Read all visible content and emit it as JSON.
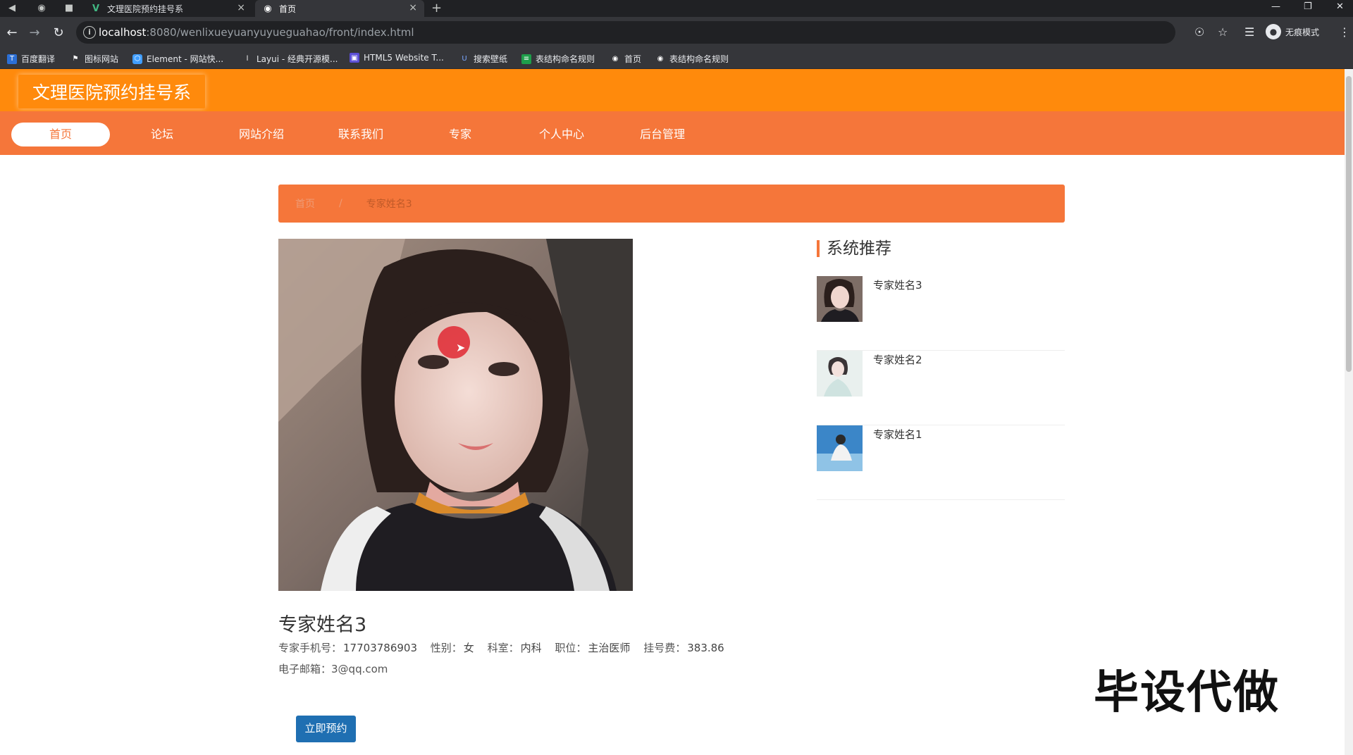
{
  "browser": {
    "tabs": [
      {
        "title": "文理医院预约挂号系",
        "active": false
      },
      {
        "title": "首页",
        "active": true
      }
    ],
    "url_host": "localhost",
    "url_rest": ":8080/wenlixueyuanyuyueguahao/front/index.html",
    "incognito_label": "无痕模式",
    "bookmarks": [
      "百度翻译",
      "图标网站",
      "Element - 网站快...",
      "Layui - 经典开源模...",
      "HTML5 Website T...",
      "搜索壁纸",
      "表结构命名规则",
      "首页",
      "表结构命名规则"
    ]
  },
  "site": {
    "title": "文理医院预约挂号系",
    "nav": [
      {
        "label": "首页",
        "active": true
      },
      {
        "label": "论坛",
        "active": false
      },
      {
        "label": "网站介绍",
        "active": false
      },
      {
        "label": "联系我们",
        "active": false
      },
      {
        "label": "专家",
        "active": false
      },
      {
        "label": "个人中心",
        "active": false
      },
      {
        "label": "后台管理",
        "active": false
      }
    ]
  },
  "breadcrumb": {
    "home": "首页",
    "separator": "/",
    "current": "专家姓名3"
  },
  "expert": {
    "name": "专家姓名3",
    "phone_label": "专家手机号：",
    "phone": "17703786903",
    "gender_label": "性别：",
    "gender": "女",
    "dept_label": "科室：",
    "dept": "内科",
    "position_label": "职位：",
    "position": "主治医师",
    "fee_label": "挂号费：",
    "fee": "383.86",
    "email_label": "电子邮箱：",
    "email": "3@qq.com",
    "book_button": "立即预约"
  },
  "sidebar": {
    "title": "系统推荐",
    "items": [
      {
        "name": "专家姓名3"
      },
      {
        "name": "专家姓名2"
      },
      {
        "name": "专家姓名1"
      }
    ]
  },
  "watermark": "毕设代做",
  "colors": {
    "header": "#ff8a0c",
    "nav": "#f5763a",
    "button": "#1f6fb2"
  }
}
